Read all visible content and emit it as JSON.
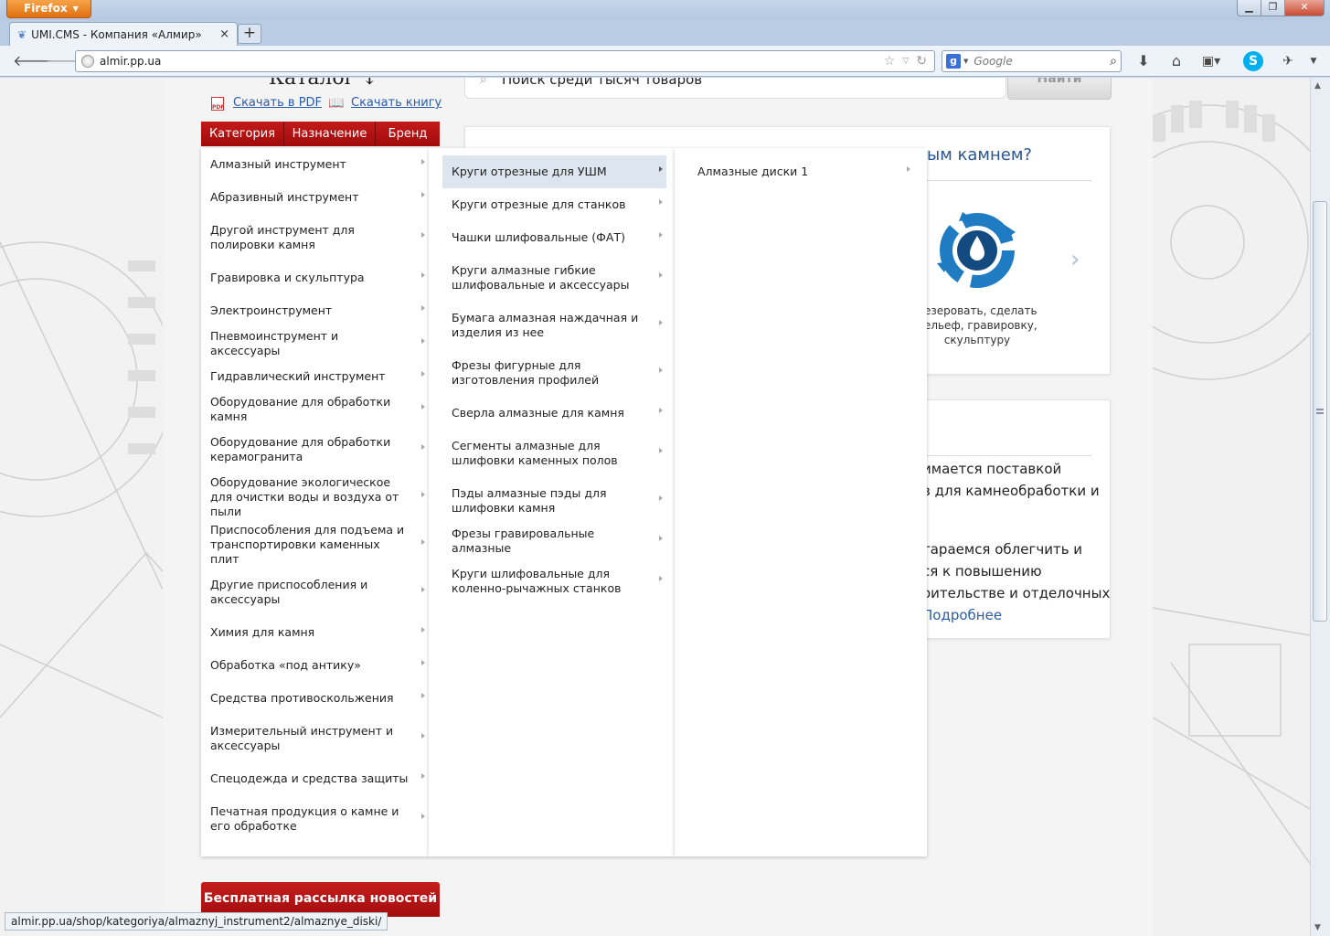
{
  "browser": {
    "app_button": "Firefox",
    "tab_title": "UMI.CMS - Компания «Алмир»",
    "url": "almir.pp.ua",
    "search_placeholder": "Google",
    "status_url": "almir.pp.ua/shop/kategoriya/almaznyj_instrument2/almaznye_diski/"
  },
  "catalog": {
    "title": "Каталог ↓",
    "download_pdf": "Скачать в PDF",
    "download_book": "Скачать книгу",
    "tabs": [
      "Категория",
      "Назначение",
      "Бренд"
    ]
  },
  "search": {
    "placeholder": "Поиск среди тысяч товаров",
    "button": "Найти"
  },
  "menu1": [
    "Алмазный инструмент",
    "Абразивный инструмент",
    "Другой инструмент для полировки камня",
    "Гравировка и скульптура",
    "Электроинструмент",
    "Пневмоинструмент и аксессуары",
    "Гидравлический инструмент",
    "Оборудование для обработки камня",
    "Оборудование для обработки керамогранита",
    "Оборудование экологическое для очистки воды и воздуха от пыли",
    "Приспособления для подъема и транспортировки каменных плит",
    "Другие приспособления и аксессуары",
    "Химия для камня",
    "Обработка «под антику»",
    "Средства противоскольжения",
    "Измерительный инструмент и аксессуары",
    "Спецодежда и средства защиты",
    "Печатная продукция о камне и его обработке"
  ],
  "menu2": [
    "Круги отрезные для УШМ",
    "Круги отрезные для станков",
    "Чашки шлифовальные (ФАТ)",
    "Круги алмазные гибкие шлифовальные и аксессуары",
    "Бумага алмазная наждачная и изделия из нее",
    "Фрезы фигурные для изготовления профилей",
    "Сверла алмазные для камня",
    "Сегменты алмазные для шлифовки каменных полов",
    "Пэды алмазные пэды для шлифовки камня",
    "Фрезы гравировальные алмазные",
    "Круги шлифовальные для коленно-рычажных станков"
  ],
  "menu3": [
    "Алмазные диски 1"
  ],
  "promo": {
    "heading": "ым камнем?",
    "text": "резеровать, сделать рельеф, гравировку, скульптуру"
  },
  "about": {
    "lines": [
      "имается поставкой",
      "в для камнеобработки и",
      "тараемся облегчить и",
      "ся к повышению",
      "оительстве и отделочных"
    ],
    "more": "Подробнее"
  },
  "newsletter": "Бесплатная рассылка новостей",
  "colors": {
    "brand_red": "#b51010",
    "link_blue": "#2b5ca8",
    "heading_blue": "#2b5590"
  }
}
